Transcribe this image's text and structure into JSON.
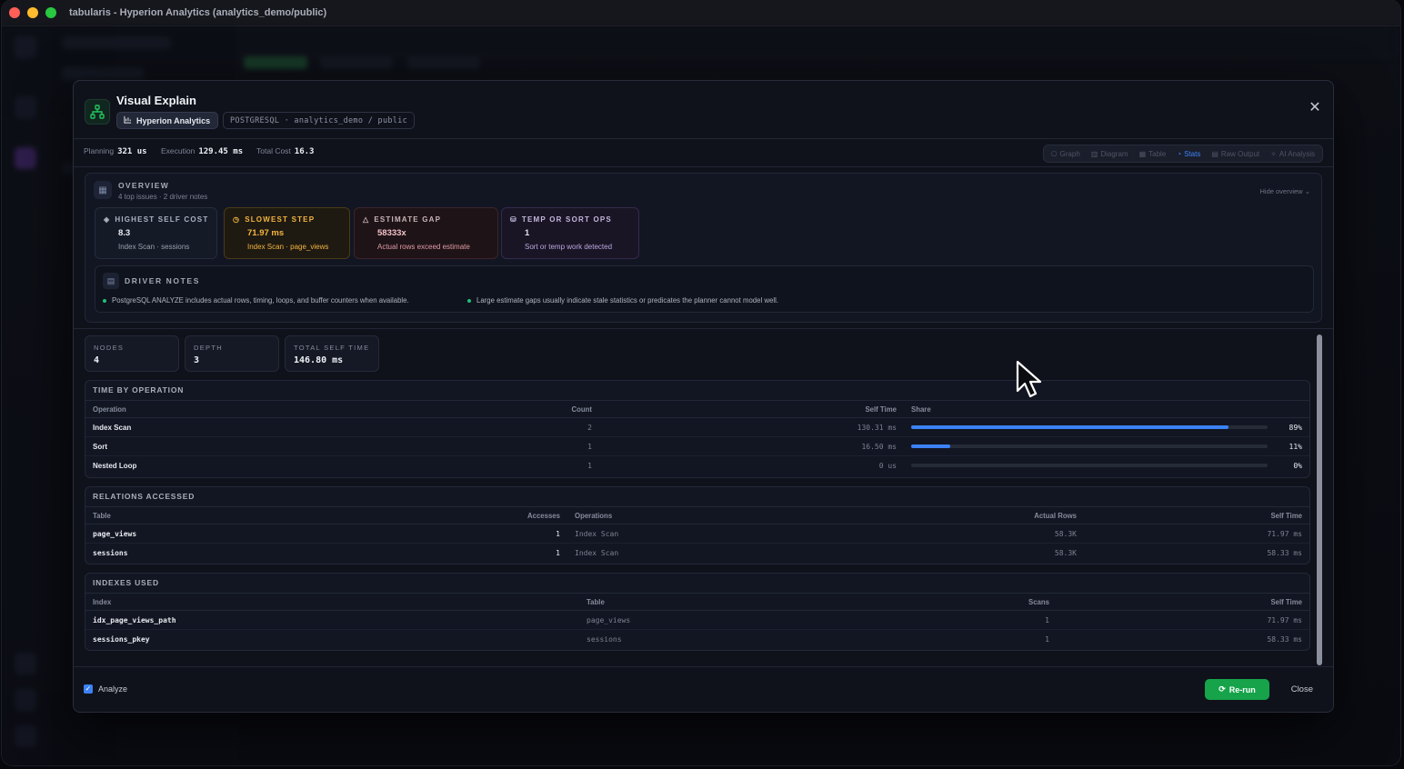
{
  "window": {
    "title": "tabularis - Hyperion Analytics (analytics_demo/public)"
  },
  "modal": {
    "title": "Visual Explain",
    "connection": "Hyperion Analytics",
    "database": "POSTGRESQL · analytics_demo / public",
    "metrics": {
      "planning_label": "Planning",
      "planning_value": "321 us",
      "execution_label": "Execution",
      "execution_value": "129.45 ms",
      "cost_label": "Total Cost",
      "cost_value": "16.3"
    },
    "tabs": [
      {
        "label": "Graph",
        "icon": "graph-icon"
      },
      {
        "label": "Diagram",
        "icon": "chart-icon"
      },
      {
        "label": "Table",
        "icon": "table-icon"
      },
      {
        "label": "Stats",
        "icon": "stats-icon",
        "active": true
      },
      {
        "label": "Raw Output",
        "icon": "file-icon"
      },
      {
        "label": "AI Analysis",
        "icon": "sparkle-icon"
      }
    ]
  },
  "overview": {
    "label": "OVERVIEW",
    "sub": "4 top issues · 2 driver notes",
    "hide": "Hide overview",
    "cards": [
      {
        "title": "HIGHEST SELF COST",
        "value": "8.3",
        "sub": "Index Scan · sessions",
        "icon": "layers-icon"
      },
      {
        "title": "SLOWEST STEP",
        "value": "71.97 ms",
        "sub": "Index Scan · page_views",
        "icon": "clock-icon"
      },
      {
        "title": "ESTIMATE GAP",
        "value": "58333x",
        "sub": "Actual rows exceed estimate",
        "icon": "warning-icon"
      },
      {
        "title": "TEMP OR SORT OPS",
        "value": "1",
        "sub": "Sort or temp work detected",
        "icon": "database-icon"
      }
    ],
    "driver": {
      "label": "DRIVER NOTES",
      "notes": [
        "PostgreSQL ANALYZE includes actual rows, timing, loops, and buffer counters when available.",
        "Large estimate gaps usually indicate stale statistics or predicates the planner cannot model well."
      ]
    }
  },
  "stats": {
    "nodes_label": "NODES",
    "nodes_value": "4",
    "depth_label": "DEPTH",
    "depth_value": "3",
    "self_label": "TOTAL SELF TIME",
    "self_value": "146.80 ms"
  },
  "time_by_operation": {
    "title": "TIME BY OPERATION",
    "headers": [
      "Operation",
      "Count",
      "Self Time",
      "Share"
    ],
    "rows": [
      {
        "op": "Index Scan",
        "count": "2",
        "self": "130.31 ms",
        "share": 0.89,
        "share_label": "89%"
      },
      {
        "op": "Sort",
        "count": "1",
        "self": "16.50 ms",
        "share": 0.11,
        "share_label": "11%"
      },
      {
        "op": "Nested Loop",
        "count": "1",
        "self": "0 us",
        "share": 0,
        "share_label": "0%"
      }
    ]
  },
  "relations": {
    "title": "RELATIONS ACCESSED",
    "headers": [
      "Table",
      "Accesses",
      "Operations",
      "Actual Rows",
      "Self Time"
    ],
    "rows": [
      [
        "page_views",
        "1",
        "Index Scan",
        "58.3K",
        "71.97 ms"
      ],
      [
        "sessions",
        "1",
        "Index Scan",
        "58.3K",
        "58.33 ms"
      ]
    ]
  },
  "indexes": {
    "title": "INDEXES USED",
    "headers": [
      "Index",
      "Table",
      "Scans",
      "Self Time"
    ],
    "rows": [
      [
        "idx_page_views_path",
        "page_views",
        "1",
        "71.97 ms"
      ],
      [
        "sessions_pkey",
        "sessions",
        "1",
        "58.33 ms"
      ]
    ]
  },
  "footer": {
    "analyze": "Analyze",
    "rerun": "Re-run",
    "close": "Close"
  }
}
